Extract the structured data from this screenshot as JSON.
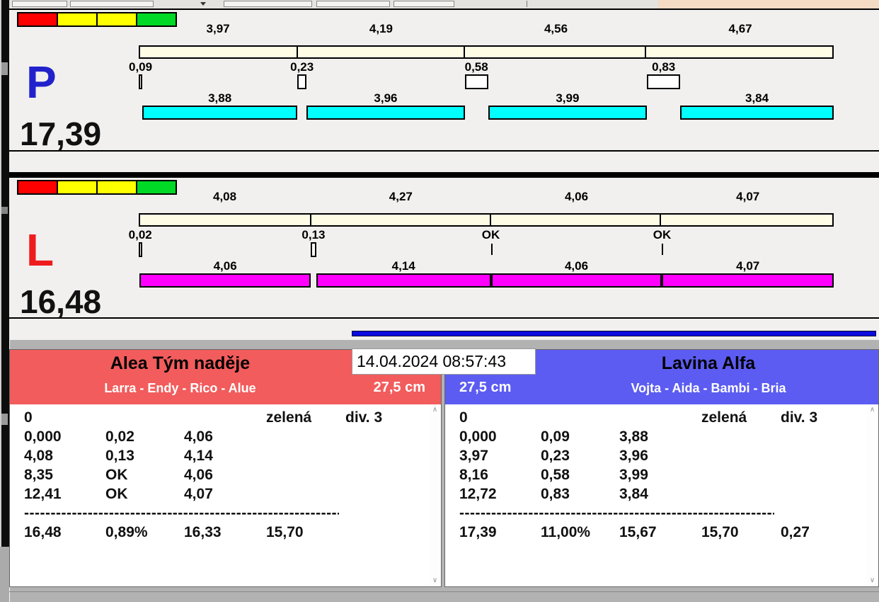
{
  "match": {
    "datetime": "14.04.2024 08:57:43",
    "left_team": {
      "name": "Alea Tým naděje",
      "dogs": "Larra - Endy - Rico - Alue",
      "jump_height": "27,5 cm",
      "result_rows": [
        [
          "0",
          "",
          "",
          "zelená",
          "div. 3"
        ],
        [
          "0,000",
          "0,02",
          "4,06",
          "",
          ""
        ],
        [
          "4,08",
          "0,13",
          "4,14",
          "",
          ""
        ],
        [
          "8,35",
          "OK",
          "4,06",
          "",
          ""
        ],
        [
          "12,41",
          "OK",
          "4,07",
          "",
          ""
        ]
      ],
      "separator": "--------------------------------------------------------------",
      "totals": [
        "16,48",
        "0,89%",
        "16,33",
        "15,70",
        ""
      ]
    },
    "right_team": {
      "name": "Lavina Alfa",
      "dogs": "Vojta - Aida - Bambi - Bria",
      "jump_height": "27,5 cm",
      "result_rows": [
        [
          "0",
          "",
          "",
          "zelená",
          "div. 3"
        ],
        [
          "0,000",
          "0,09",
          "3,88",
          "",
          ""
        ],
        [
          "3,97",
          "0,23",
          "3,96",
          "",
          ""
        ],
        [
          "8,16",
          "0,58",
          "3,99",
          "",
          ""
        ],
        [
          "12,72",
          "0,83",
          "3,84",
          "",
          ""
        ]
      ],
      "separator": "--------------------------------------------------------------",
      "totals": [
        "17,39",
        "11,00%",
        "15,67",
        "15,70",
        "0,27"
      ]
    }
  },
  "lanes": [
    {
      "id": "P",
      "letter": "P",
      "letter_color": "#2222cc",
      "total": "17,39",
      "bar_color": "#00ffff",
      "segments": [
        {
          "split": "3,97",
          "gap": "0,09",
          "run": "3,88"
        },
        {
          "split": "4,19",
          "gap": "0,23",
          "run": "3,96"
        },
        {
          "split": "4,56",
          "gap": "0,58",
          "run": "3,99"
        },
        {
          "split": "4,67",
          "gap": "0,83",
          "run": "3,84"
        }
      ]
    },
    {
      "id": "L",
      "letter": "L",
      "letter_color": "#ee1c1c",
      "total": "16,48",
      "bar_color": "#ff00ff",
      "segments": [
        {
          "split": "4,08",
          "gap": "0,02",
          "run": "4,06"
        },
        {
          "split": "4,27",
          "gap": "0,13",
          "run": "4,14"
        },
        {
          "split": "4,06",
          "gap": "OK",
          "run": "4,06"
        },
        {
          "split": "4,07",
          "gap": "OK",
          "run": "4,07"
        }
      ]
    }
  ],
  "colors": {
    "legend_red": "#ff0000",
    "legend_yellow": "#ffff00",
    "legend_green": "#00d926",
    "split_bar_fill": "#fffce6",
    "lane_p_bar": "#00ffff",
    "lane_l_bar": "#ff00ff",
    "progress_blue": "#0b0be0",
    "left_header": "#f25c5c",
    "right_header": "#5c5cf2",
    "top_strip_peach": "#f3dcc3"
  }
}
